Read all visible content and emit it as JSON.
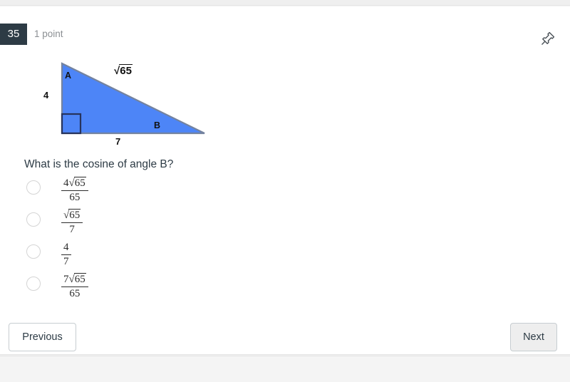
{
  "quiz": {
    "question_number": "35",
    "points_label": "1 point",
    "flag_icon": "pushpin-icon"
  },
  "figure": {
    "caption": "right triangle with vertices A (top-left), right angle (bottom-left) and B (bottom-right)",
    "vertex_a_label": "A",
    "vertex_b_label": "B",
    "leg_vertical_label": "4",
    "leg_horizontal_label": "7",
    "hypotenuse_radicand": "65",
    "hypotenuse_sign": "√",
    "fill_color": "#4d85f7",
    "stroke_color": "#6b7f9e",
    "right_angle_marker": true
  },
  "question": {
    "prompt": "What is the cosine of angle B?",
    "options": [
      {
        "id": "option-1",
        "numerator_coefficient": "4",
        "numerator_radicand": "65",
        "denominator": "65",
        "has_radical": true,
        "plain": "4√65/65"
      },
      {
        "id": "option-2",
        "numerator_coefficient": "",
        "numerator_radicand": "65",
        "denominator": "7",
        "has_radical": true,
        "plain": "√65/7"
      },
      {
        "id": "option-3",
        "numerator_coefficient": "4",
        "numerator_radicand": "",
        "denominator": "7",
        "has_radical": false,
        "plain": "4/7"
      },
      {
        "id": "option-4",
        "numerator_coefficient": "7",
        "numerator_radicand": "65",
        "denominator": "65",
        "has_radical": true,
        "plain": "7√65/65"
      }
    ],
    "radical_sign": "√"
  },
  "navigation": {
    "previous_label": "Previous",
    "next_label": "Next"
  },
  "colors": {
    "badge_background": "#2d3b45",
    "triangle_blue": "#4d85f7",
    "text_primary": "#2d3b45",
    "points_grey": "#8b8f93"
  }
}
